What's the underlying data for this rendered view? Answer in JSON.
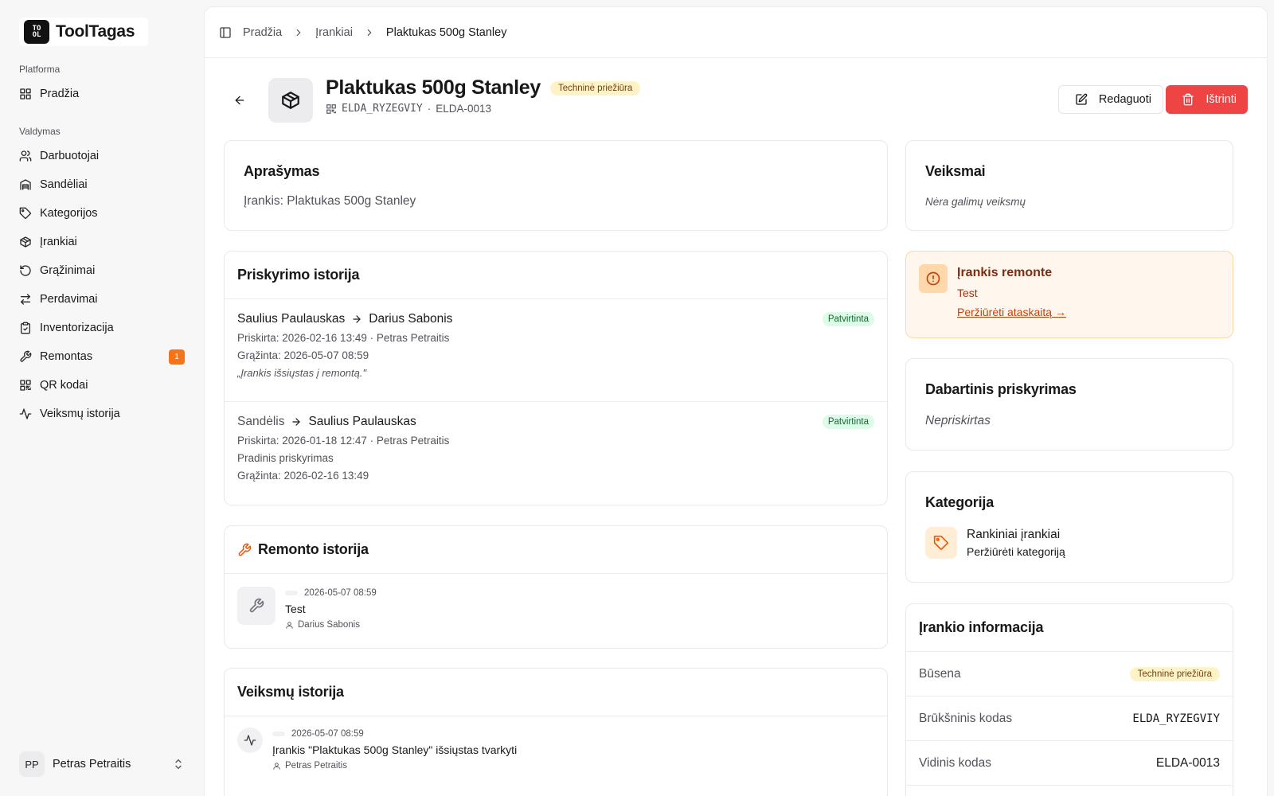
{
  "app": {
    "logo_mark": "TOOL TAG",
    "name": "ToolTagas"
  },
  "sidebar": {
    "groups": [
      {
        "label": "Platforma",
        "items": [
          {
            "label": "Pradžia",
            "icon": "dashboard-icon"
          }
        ]
      },
      {
        "label": "Valdymas",
        "items": [
          {
            "label": "Darbuotojai",
            "icon": "users-icon"
          },
          {
            "label": "Sandėliai",
            "icon": "warehouse-icon"
          },
          {
            "label": "Kategorijos",
            "icon": "tag-icon"
          },
          {
            "label": "Įrankiai",
            "icon": "package-icon"
          },
          {
            "label": "Grąžinimai",
            "icon": "rotate-ccw-icon"
          },
          {
            "label": "Perdavimai",
            "icon": "arrows-swap-icon"
          },
          {
            "label": "Inventorizacija",
            "icon": "clipboard-check-icon"
          },
          {
            "label": "Remontas",
            "icon": "wrench-icon",
            "badge": "1"
          },
          {
            "label": "QR kodai",
            "icon": "qr-code-icon"
          },
          {
            "label": "Veiksmų istorija",
            "icon": "activity-icon"
          }
        ]
      }
    ],
    "user": {
      "initials": "PP",
      "name": "Petras Petraitis"
    }
  },
  "breadcrumb": {
    "items": [
      "Pradžia",
      "Įrankiai"
    ],
    "current": "Plaktukas 500g Stanley"
  },
  "tool": {
    "title": "Plaktukas 500g Stanley",
    "status": "Techninė priežiūra",
    "barcode": "ELDA_RYZEGVIY",
    "separator": "·",
    "internal_code": "ELDA-0013",
    "edit_label": "Redaguoti",
    "delete_label": "Ištrinti"
  },
  "description": {
    "title": "Aprašymas",
    "text": "Įrankis: Plaktukas 500g Stanley"
  },
  "assignments": {
    "title": "Priskyrimo istorija",
    "rows": [
      {
        "from": "Saulius Paulauskas",
        "to": "Darius Sabonis",
        "status": "Patvirtinta",
        "lines": [
          "Priskirta: 2026-02-16 13:49 · Petras Petraitis",
          "Grąžinta: 2026-05-07 08:59"
        ],
        "note": "„Įrankis išsiųstas į remontą.\""
      },
      {
        "from": "Sandėlis",
        "to": "Saulius Paulauskas",
        "status": "Patvirtinta",
        "lines": [
          "Priskirta: 2026-01-18 12:47 · Petras Petraitis",
          "Pradinis priskyrimas",
          "Grąžinta: 2026-02-16 13:49"
        ],
        "note": ""
      }
    ]
  },
  "repair_history": {
    "title": "Remonto istorija",
    "items": [
      {
        "date": "2026-05-07 08:59",
        "title": "Test",
        "user": "Darius Sabonis"
      }
    ]
  },
  "activity_history": {
    "title": "Veiksmų istorija",
    "items": [
      {
        "date": "2026-05-07 08:59",
        "title": "Įrankis \"Plaktukas 500g Stanley\" išsiųstas tvarkyti",
        "user": "Petras Petraitis"
      }
    ]
  },
  "actions": {
    "title": "Veiksmai",
    "empty": "Nėra galimų veiksmų"
  },
  "repair_alert": {
    "title": "Įrankis remonte",
    "text": "Test",
    "link": "Peržiūrėti ataskaitą →"
  },
  "current_assignment": {
    "title": "Dabartinis priskyrimas",
    "value": "Nepriskirtas"
  },
  "category": {
    "title": "Kategorija",
    "name": "Rankiniai įrankiai",
    "link": "Peržiūrėti kategoriją"
  },
  "info": {
    "title": "Įrankio informacija",
    "rows": [
      {
        "label": "Būsena",
        "value": "Techninė priežiūra"
      },
      {
        "label": "Brūkšninis kodas",
        "value": "ELDA_RYZEGVIY"
      },
      {
        "label": "Vidinis kodas",
        "value": "ELDA-0013"
      }
    ]
  },
  "colors": {
    "danger": "#ef4444",
    "badge_orange": "#f97316",
    "warning_bg": "#fef3c7",
    "success_bg": "#dcfce7",
    "alert_bg": "#fff7ed"
  }
}
